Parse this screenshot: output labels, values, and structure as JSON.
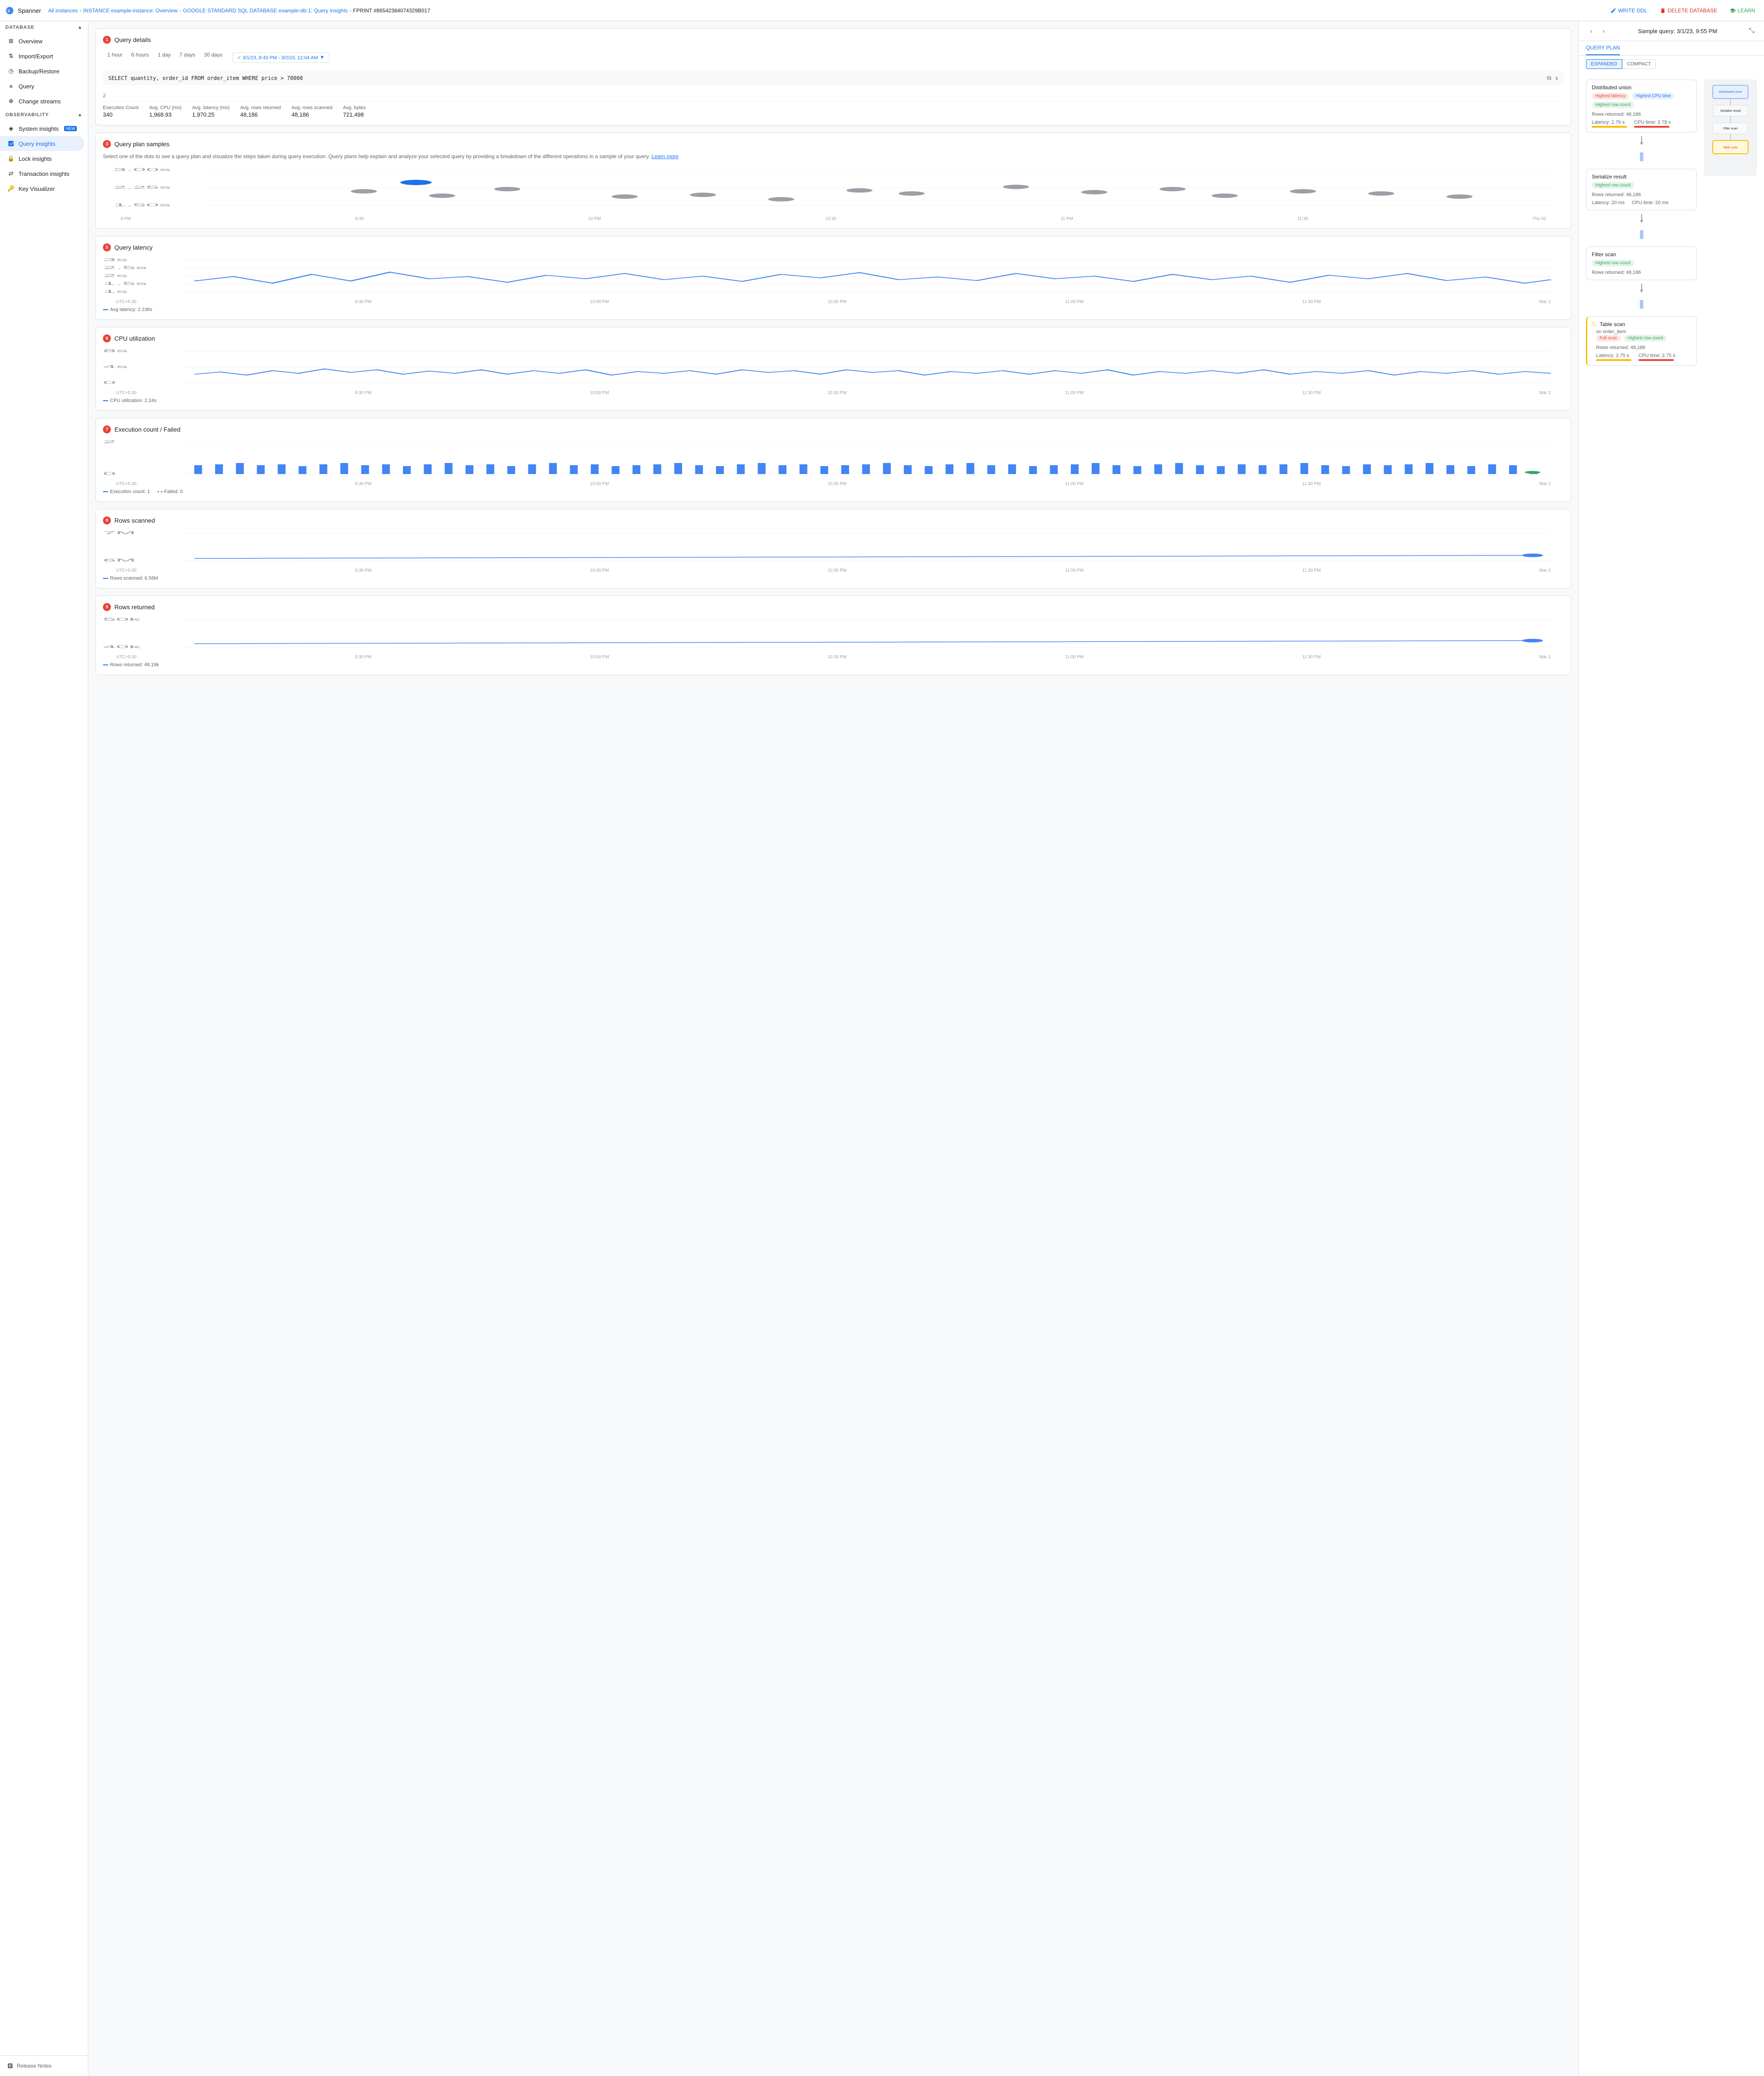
{
  "app": {
    "name": "Spanner"
  },
  "breadcrumb": {
    "items": [
      "All instances",
      "INSTANCE example-instance: Overview",
      "GOOGLE STANDARD SQL DATABASE example-db-1: Query insights",
      "FPRINT #86542384074329B017"
    ]
  },
  "top_actions": [
    {
      "label": "WRITE DDL",
      "icon": "edit-icon",
      "color": "blue"
    },
    {
      "label": "DELETE DATABASE",
      "icon": "delete-icon",
      "color": "red"
    },
    {
      "label": "LEARN",
      "icon": "book-icon",
      "color": "green"
    }
  ],
  "sidebar": {
    "database_label": "DATABASE",
    "db_items": [
      {
        "label": "Overview",
        "icon": "overview-icon"
      },
      {
        "label": "Import/Export",
        "icon": "import-icon"
      },
      {
        "label": "Backup/Restore",
        "icon": "backup-icon"
      },
      {
        "label": "Query",
        "icon": "query-icon"
      },
      {
        "label": "Change streams",
        "icon": "streams-icon"
      }
    ],
    "observability_label": "OBSERVABILITY",
    "obs_items": [
      {
        "label": "System insights",
        "icon": "system-icon",
        "badge": "NEW"
      },
      {
        "label": "Query insights",
        "icon": "query-insights-icon",
        "active": true
      },
      {
        "label": "Lock insights",
        "icon": "lock-icon"
      },
      {
        "label": "Transaction insights",
        "icon": "transaction-icon"
      },
      {
        "label": "Key Visualizer",
        "icon": "key-icon"
      }
    ],
    "bottom": {
      "label": "Release Notes"
    }
  },
  "query_details": {
    "section_num": "1",
    "title": "Query details",
    "time_tabs": [
      "1 hour",
      "6 hours",
      "1 day",
      "7 days",
      "30 days"
    ],
    "active_tab": "1 hour",
    "date_range": "✓ 3/1/23, 8:43 PM - 3/2/23, 12:04 AM",
    "sql": "SELECT quantity, order_id FROM order_item WHERE price > 70000",
    "metrics": [
      {
        "label": "Execution Count",
        "value": "340"
      },
      {
        "label": "Avg. CPU (ms)",
        "value": "1,968.93"
      },
      {
        "label": "Avg. latency (ms)",
        "value": "1,970.25"
      },
      {
        "label": "Avg. rows returned",
        "value": "48,186"
      },
      {
        "label": "Avg. rows scanned",
        "value": "48,186"
      },
      {
        "label": "Avg. bytes",
        "value": "721,498"
      }
    ]
  },
  "query_plan_samples": {
    "section_num": "2",
    "label_num": "3",
    "title": "Query plan samples",
    "description": "Select one of the dots to see a query plan and visualize the steps taken during query execution. Query plans help explain and analyze your selected query by providing a breakdown of the different operations in a sample of your query.",
    "learn_more": "Learn more",
    "y_labels": [
      "3.00s",
      "2.25s",
      "1.50s"
    ],
    "x_labels": [
      "9 PM",
      "9:30",
      "10 PM",
      "10:30",
      "11 PM",
      "11:30",
      "Thu 02"
    ]
  },
  "query_latency": {
    "section_num": "5",
    "title": "Query latency",
    "y_max": "3s",
    "y_mid1": "2.5s",
    "y_mid2": "2s",
    "y_mid3": "1.5s",
    "y_min": "1s",
    "x_labels": [
      "UTC+5:30",
      "9:30 PM",
      "10:00 PM",
      "10:30 PM",
      "11:00 PM",
      "11:30 PM",
      "Mar 2"
    ],
    "legend": "Avg latency: 2.236s"
  },
  "cpu_util": {
    "section_num": "6",
    "title": "CPU utilization",
    "y_max": "8s",
    "y_mid": "4s",
    "y_min": "0",
    "x_labels": [
      "UTC+5:30",
      "9:30 PM",
      "10:00 PM",
      "10:30 PM",
      "11:00 PM",
      "11:30 PM",
      "Mar 2"
    ],
    "legend": "CPU utilization: 2.24s"
  },
  "exec_count": {
    "section_num": "7",
    "title": "Execution count / Failed",
    "y_max": "2",
    "y_min": "0",
    "x_labels": [
      "UTC+5:30",
      "9:30 PM",
      "10:00 PM",
      "10:30 PM",
      "11:00 PM",
      "11:30 PM",
      "Mar 2"
    ],
    "legend1": "Execution count: 1",
    "legend2": "Failed: 0"
  },
  "rows_scanned": {
    "section_num": "8",
    "title": "Rows scanned",
    "y_max": "7M",
    "y_min": "6M",
    "x_labels": [
      "UTC+5:30",
      "9:30 PM",
      "10:00 PM",
      "10:30 PM",
      "11:00 PM",
      "11:30 PM",
      "Mar 2"
    ],
    "legend": "Rows scanned: 6.58M"
  },
  "rows_returned": {
    "section_num": "9",
    "title": "Rows returned",
    "y_max": "50k",
    "y_min": "40k",
    "x_labels": [
      "UTC+5:30",
      "9:30 PM",
      "10:00 PM",
      "10:30 PM",
      "11:00 PM",
      "11:30 PM",
      "Mar 2"
    ],
    "legend": "Rows returned: 48.19k"
  },
  "right_panel": {
    "title": "Sample query: 3/1/23, 9:55 PM",
    "tabs": [
      "QUERY PLAN"
    ],
    "view_btns": [
      "EXPANDED",
      "COMPACT"
    ],
    "active_view": "EXPANDED",
    "plan_nodes": [
      {
        "title": "Distributed union",
        "badges": [
          "Highest latency",
          "Highest CPU time",
          "Highest row count"
        ],
        "badge_types": [
          "orange",
          "blue",
          "green"
        ],
        "rows": "Rows returned: 48,186",
        "latency": "Latency: 2.76 s",
        "cpu": "CPU time: 2.78 s",
        "has_latency_bar": true,
        "has_cpu_bar": true
      },
      {
        "title": "Serialize result",
        "badges": [
          "Highest row count"
        ],
        "badge_types": [
          "green"
        ],
        "rows": "Rows returned: 48,186",
        "latency": "Latency: 20 ms",
        "cpu": "CPU time: 20 ms",
        "has_latency_bar": false,
        "has_cpu_bar": false
      },
      {
        "title": "Filter scan",
        "badges": [
          "Highest row count"
        ],
        "badge_types": [
          "green"
        ],
        "rows": "Rows returned: 48,186",
        "has_latency_bar": false,
        "has_cpu_bar": false
      },
      {
        "title": "Table scan",
        "sub": "on order_item",
        "badges": [
          "Full scan",
          "Highest row count"
        ],
        "badge_types": [
          "orange",
          "green"
        ],
        "rows": "Rows returned: 48,186",
        "latency": "Latency: 2.75 s",
        "cpu": "CPU time: 2.75 s",
        "warning": true,
        "has_latency_bar": true,
        "has_cpu_bar": true
      }
    ]
  }
}
